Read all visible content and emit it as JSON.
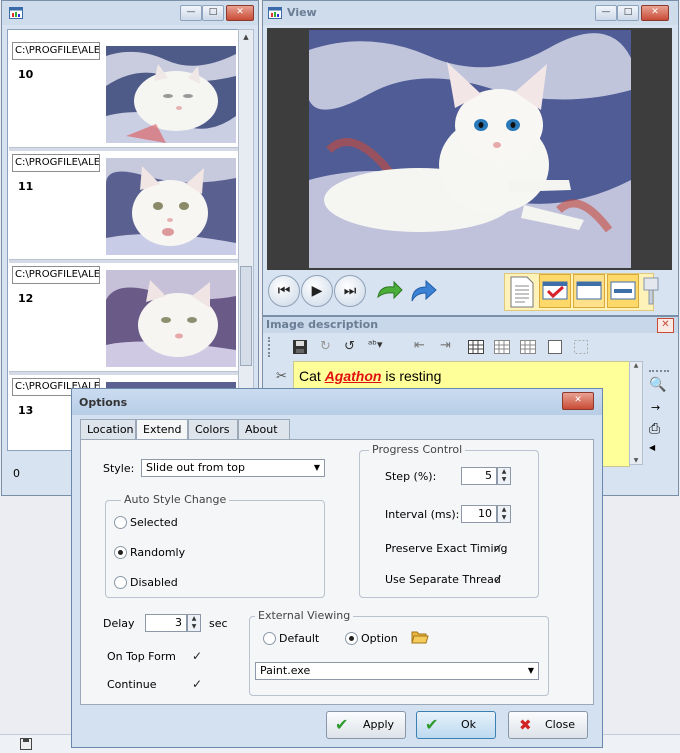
{
  "left_window": {
    "items": [
      {
        "path": "C:\\PROGFILE\\ALE",
        "number": "10"
      },
      {
        "path": "C:\\PROGFILE\\ALE",
        "number": "11"
      },
      {
        "path": "C:\\PROGFILE\\ALE",
        "number": "12"
      },
      {
        "path": "C:\\PROGFILE\\ALE",
        "number": "13"
      }
    ],
    "status": "0"
  },
  "view_window": {
    "title": "View"
  },
  "image_description": {
    "title": "Image description",
    "text_pre": "Cat ",
    "text_name": "Agathon",
    "text_post": " is resting"
  },
  "options_dialog": {
    "title": "Options",
    "tabs": [
      "Location",
      "Extend",
      "Colors",
      "About"
    ],
    "active_tab": "Extend",
    "style_label": "Style:",
    "style_value": "Slide out from top",
    "auto_style_group": "Auto Style Change",
    "auto_style_options": [
      "Selected",
      "Randomly",
      "Disabled"
    ],
    "auto_style_selected": "Randomly",
    "progress_group": "Progress Control",
    "step_label": "Step (%):",
    "step_value": "5",
    "interval_label": "Interval (ms):",
    "interval_value": "10",
    "preserve_label": "Preserve Exact Timing",
    "preserve_checked": true,
    "separate_label": "Use Separate Thread",
    "separate_checked": true,
    "delay_label": "Delay",
    "delay_value": "3",
    "delay_unit": "sec",
    "ontop_label": "On Top Form",
    "ontop_checked": true,
    "continue_label": "Continue",
    "continue_checked": true,
    "external_group": "External Viewing",
    "external_options": [
      "Default",
      "Option"
    ],
    "external_selected": "Option",
    "external_program": "Paint.exe",
    "buttons": {
      "apply": "Apply",
      "ok": "Ok",
      "close": "Close"
    }
  },
  "colors": {
    "accent_blue": "#3c6fa8",
    "highlight_yellow": "#ffff99",
    "name_red": "#e01010",
    "close_red": "#c84b36"
  }
}
